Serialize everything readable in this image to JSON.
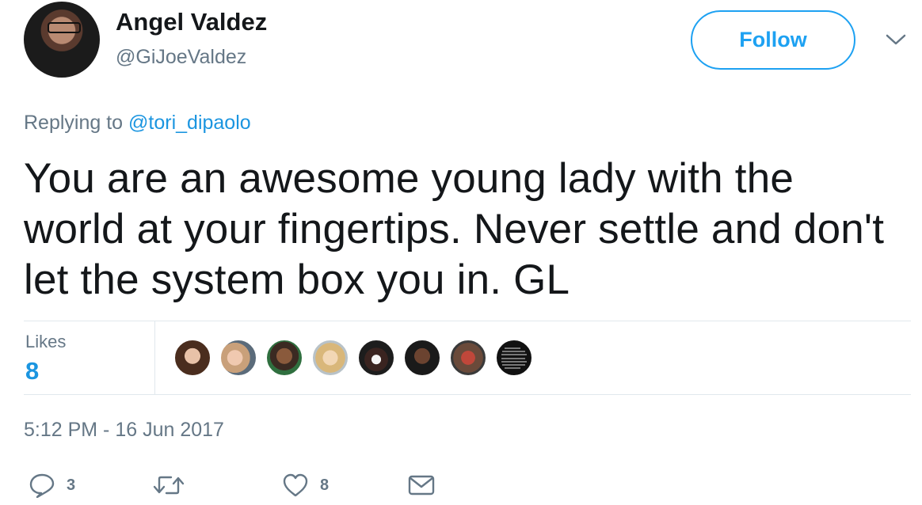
{
  "author": {
    "name": "Angel Valdez",
    "handle": "@GiJoeValdez"
  },
  "follow_button": {
    "label": "Follow"
  },
  "reply": {
    "prefix": "Replying to ",
    "mention": "@tori_dipaolo"
  },
  "tweet": {
    "text": "You are an awesome young lady with the world at your fingertips. Never settle and don't let the system box you in. GL"
  },
  "likes": {
    "label": "Likes",
    "count": "8",
    "avatars": [
      "liker-1",
      "liker-2",
      "liker-3",
      "liker-4",
      "liker-5",
      "liker-6",
      "liker-7",
      "liker-8"
    ]
  },
  "timestamp": "5:12 PM - 16 Jun 2017",
  "actions": {
    "reply_count": "3",
    "retweet_count": "",
    "like_count": "8"
  },
  "colors": {
    "accent": "#1da1f2",
    "link": "#1b95e0",
    "muted": "#657786",
    "text": "#14171a",
    "divider": "#e1e8ed"
  },
  "icons": [
    "chevron-down-icon",
    "reply-icon",
    "retweet-icon",
    "heart-icon",
    "mail-icon"
  ]
}
